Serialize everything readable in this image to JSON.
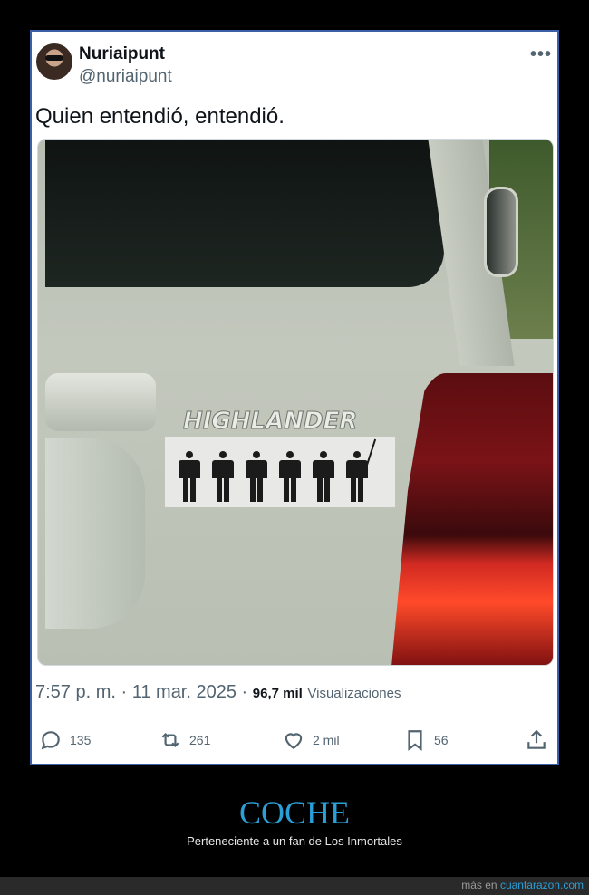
{
  "tweet": {
    "display_name": "Nuriaipunt",
    "handle": "@nuriaipunt",
    "more_icon": "more-horizontal-icon",
    "text": "Quien entendió, entendió.",
    "photo": {
      "emblem_text": "HIGHLANDER"
    },
    "timestamp": "7:57 p. m. · 11 mar. 2025 ·",
    "views_count": "96,7 mil",
    "views_label": "Visualizaciones",
    "actions": {
      "replies": "135",
      "retweets": "261",
      "likes": "2 mil",
      "bookmarks": "56"
    }
  },
  "caption": {
    "title": "COCHE",
    "subtitle": "Perteneciente a un fan de Los Inmortales"
  },
  "footer": {
    "prefix": "más en",
    "site": "cuantarazon.com"
  },
  "colors": {
    "accent": "#2a9fd8",
    "card_border": "#3b5fa8",
    "secondary_text": "#536471"
  }
}
